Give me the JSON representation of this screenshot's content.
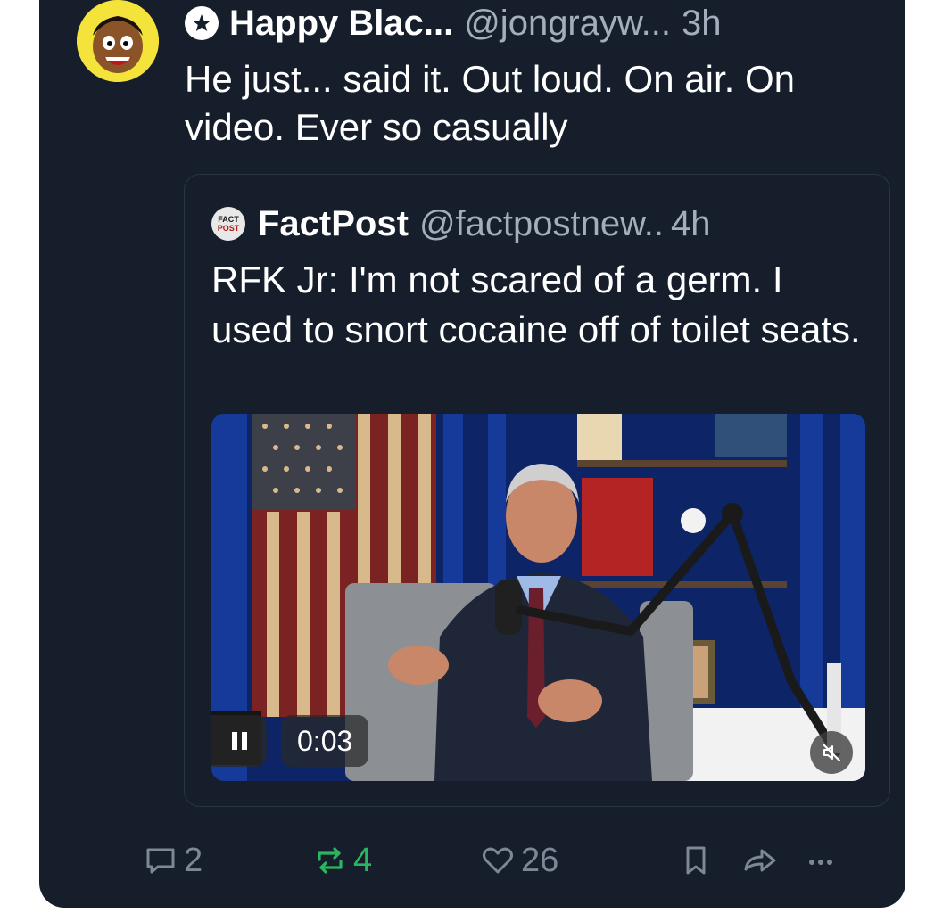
{
  "post": {
    "author_name": "Happy Blac...",
    "handle": "@jongrayw...",
    "time": "3h",
    "text": "He just... said it. Out loud. On air. On video. Ever so casually",
    "avatar_icon": "cartoon-face-avatar"
  },
  "quote": {
    "author_name": "FactPost",
    "handle": "@factpostnew..",
    "time": "4h",
    "logo_text_top": "FACT",
    "logo_text_bottom": "POST",
    "text": "RFK Jr: I'm not scared of a germ. I used to snort cocaine off of toilet seats.",
    "video": {
      "elapsed": "0:03",
      "state": "playing",
      "muted": true
    }
  },
  "actions": {
    "replies": "2",
    "reposts": "4",
    "likes": "26",
    "repost_color": "#29b561"
  },
  "colors": {
    "background": "#161e2b",
    "text": "#ffffff",
    "muted_text": "#a4adbb",
    "border": "#2a3444"
  }
}
